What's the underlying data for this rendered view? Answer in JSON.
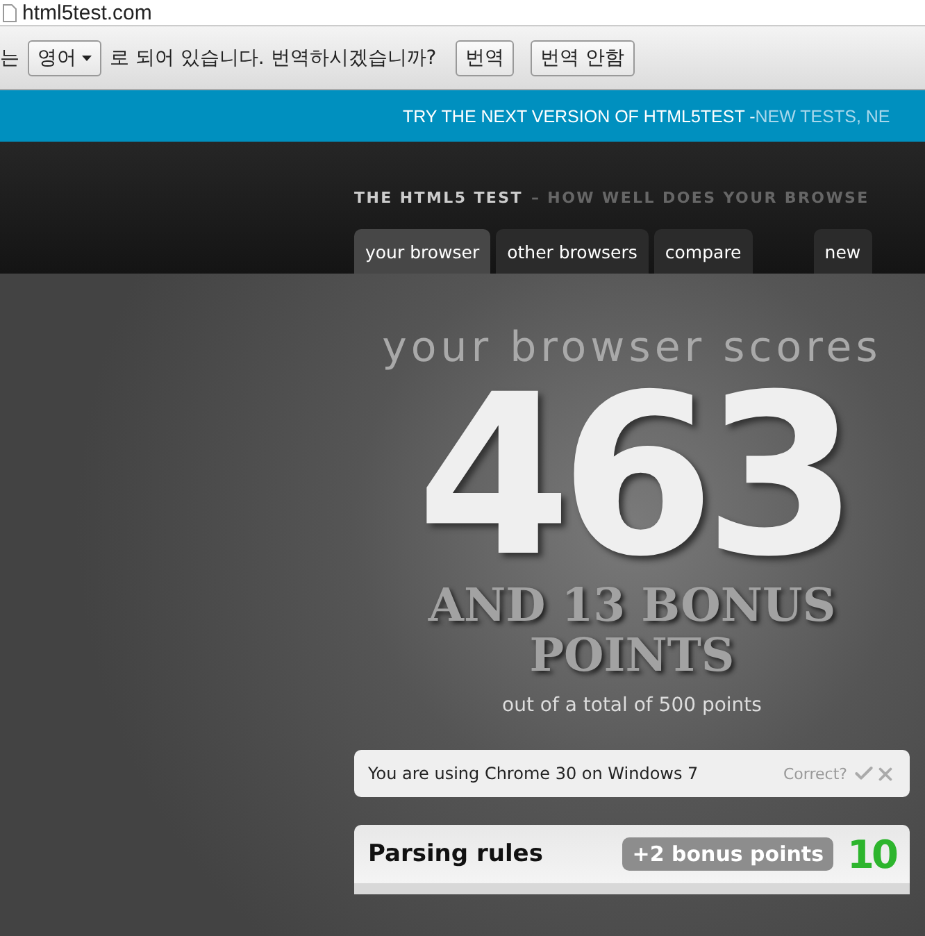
{
  "address_bar": {
    "url": "html5test.com"
  },
  "translate_bar": {
    "prefix": "는",
    "language": "영어",
    "message": "로 되어 있습니다. 번역하시겠습니까?",
    "buttons": [
      "번역",
      "번역 안함"
    ]
  },
  "banner": {
    "text": "TRY THE NEXT VERSION OF HTML5TEST - ",
    "highlight": "NEW TESTS, NE"
  },
  "header": {
    "title": "THE HTML5 TEST",
    "subtitle": "– HOW WELL DOES YOUR BROWSE"
  },
  "tabs": [
    {
      "label": "your browser",
      "selected": true
    },
    {
      "label": "other browsers",
      "selected": false
    },
    {
      "label": "compare",
      "selected": false
    },
    {
      "label": "new",
      "selected": false
    }
  ],
  "score": {
    "intro": "your browser scores",
    "points": "463",
    "bonus": "AND 13 BONUS POINTS",
    "total": "out of a total of 500 points"
  },
  "browser_info": {
    "text": "You are using Chrome 30 on Windows 7",
    "question": "Correct?"
  },
  "sections": [
    {
      "title": "Parsing rules",
      "bonus": "+2 bonus points",
      "score": "10"
    }
  ]
}
